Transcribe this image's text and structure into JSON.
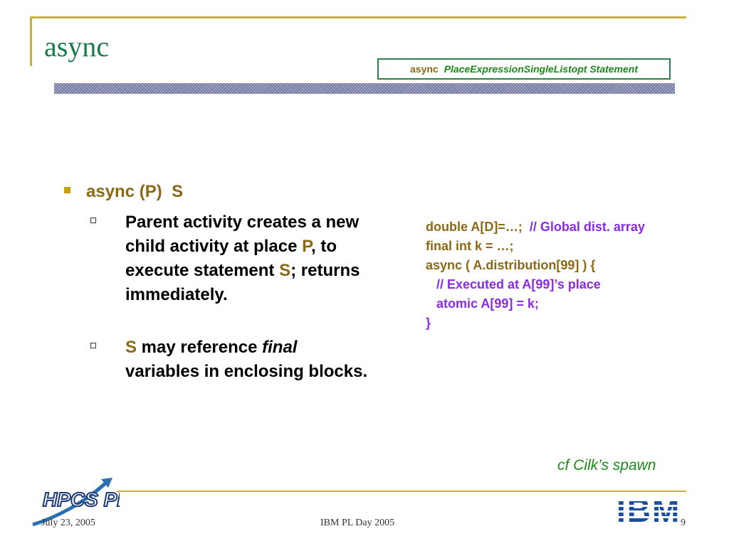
{
  "slide": {
    "title": "async",
    "syntax": {
      "keyword": "async",
      "rest": "PlaceExpressionSingleListopt Statement"
    },
    "bullet1": {
      "kw": "async (P)",
      "s": "S"
    },
    "sub1": {
      "t1": "Parent activity creates a new child activity at place ",
      "p": "P",
      "t2": ", to execute statement ",
      "s": "S",
      "t3": "; returns immediately."
    },
    "sub2": {
      "s": "S",
      "t1": " may reference ",
      "final": "final",
      "t2": " variables in enclosing blocks."
    },
    "code": {
      "l1a": "double A[D]=…;  ",
      "l1b": "// Global dist. array",
      "l2": "final int k = …;",
      "l3": "async ( A.distribution[99] ) {",
      "l4": "   // Executed at A[99]’s place",
      "l5": "   atomic A[99] = k;",
      "l6": "}"
    },
    "cf": "cf Cilk’s spawn"
  },
  "footer": {
    "date": "July 23, 2005",
    "center": "IBM PL Day 2005",
    "page": "9"
  },
  "logos": {
    "left": "HPCS PERCS",
    "right": "IBM"
  },
  "colors": {
    "title": "#1a7a4a",
    "gold": "#8b6914",
    "comment": "#8a2be2",
    "green": "#1a8a1a",
    "rule": "#c8b040"
  }
}
